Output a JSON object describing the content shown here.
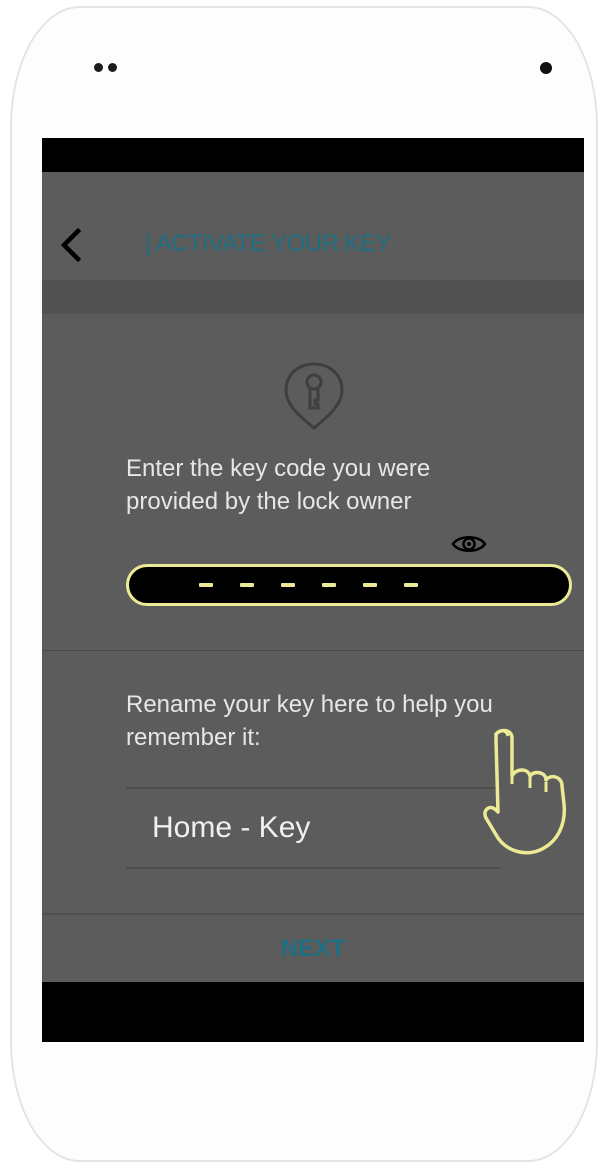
{
  "header": {
    "title": "| ACTIVATE YOUR KEY",
    "back_icon": "chevron-left-icon"
  },
  "main": {
    "key_icon": "key-pin-icon",
    "instruction": "Enter the key code you were provided by the lock owner",
    "reveal_icon": "eye-icon",
    "code_placeholder_dashes": 6,
    "rename_label": "Rename your key here to help you remember it:",
    "key_name_value": "Home - Key",
    "next_label": "NEXT"
  },
  "overlay": {
    "gesture_icon": "tap-hand-icon"
  },
  "colors": {
    "accent": "#1e6f82",
    "highlight": "#ecea95",
    "screen_dim": "#5c5c5c"
  }
}
